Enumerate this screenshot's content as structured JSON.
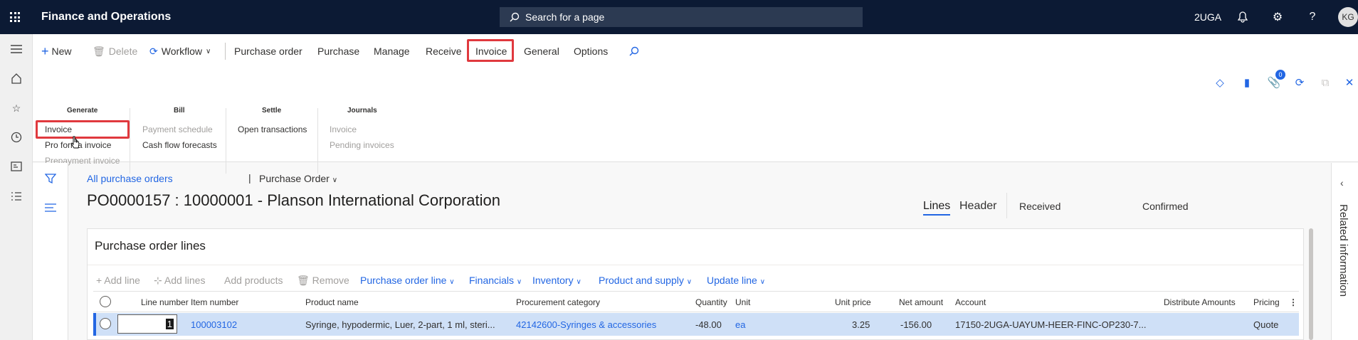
{
  "app": {
    "title": "Finance and Operations",
    "search_placeholder": "Search for a page",
    "company": "2UGA",
    "avatar": "KG"
  },
  "toolbar": {
    "new": "New",
    "delete": "Delete",
    "workflow": "Workflow",
    "tabs": [
      "Purchase order",
      "Purchase",
      "Manage",
      "Receive",
      "Invoice",
      "General",
      "Options"
    ],
    "active_tab": "Invoice",
    "notification_count": "0"
  },
  "ribbon": {
    "generate": {
      "header": "Generate",
      "items": [
        "Invoice",
        "Pro forma invoice",
        "Prepayment invoice"
      ]
    },
    "bill": {
      "header": "Bill",
      "items": [
        "Payment schedule",
        "Cash flow forecasts"
      ]
    },
    "settle": {
      "header": "Settle",
      "items": [
        "Open transactions"
      ]
    },
    "journals": {
      "header": "Journals",
      "items": [
        "Invoice",
        "Pending invoices"
      ]
    }
  },
  "page": {
    "breadcrumb": "All purchase orders",
    "view": "Purchase Order",
    "title": "PO0000157 : 10000001 - Planson International Corporation",
    "tabs": [
      "Lines",
      "Header"
    ],
    "status_received": "Received",
    "status_confirmed": "Confirmed"
  },
  "lines": {
    "title": "Purchase order lines",
    "actions": [
      "Add line",
      "Add lines",
      "Add products",
      "Remove",
      "Purchase order line",
      "Financials",
      "Inventory",
      "Product and supply",
      "Update line"
    ],
    "columns": [
      "Line number",
      "Item number",
      "Product name",
      "Procurement category",
      "Quantity",
      "Unit",
      "Unit price",
      "Net amount",
      "Account",
      "Distribute Amounts",
      "Pricing"
    ],
    "rows": [
      {
        "line": "1",
        "item": "100003102",
        "product": "Syringe, hypodermic, Luer, 2-part, 1 ml, steri...",
        "category": "42142600-Syringes & accessories",
        "qty": "-48.00",
        "unit": "ea",
        "price": "3.25",
        "net": "-156.00",
        "account": "17150-2UGA-UAYUM-HEER-FINC-OP230-7...",
        "distribute": "",
        "pricing": "Quote"
      }
    ]
  },
  "right_panel": {
    "label": "Related information"
  }
}
